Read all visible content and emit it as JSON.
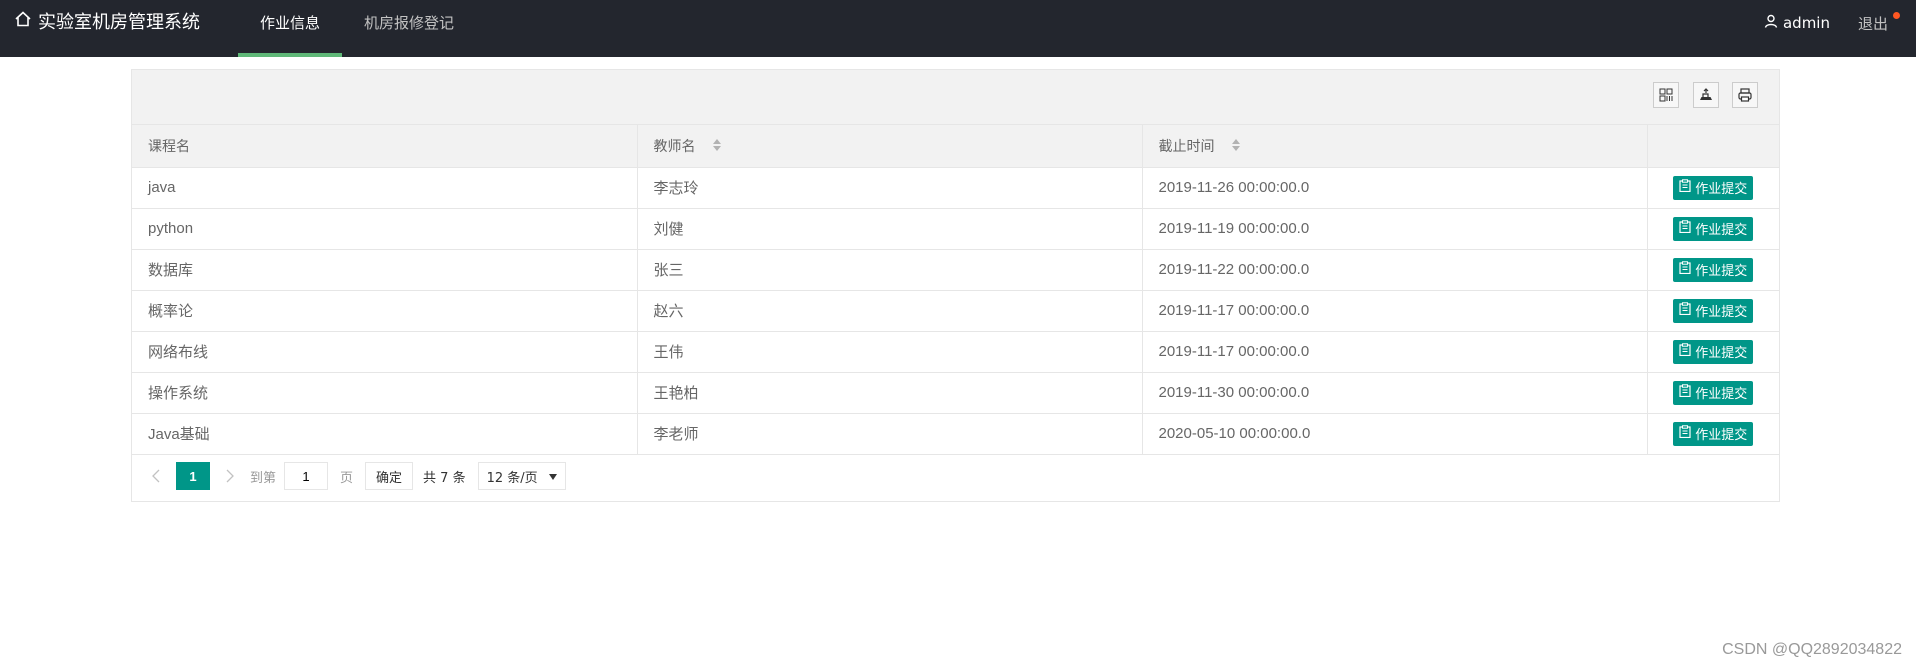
{
  "header": {
    "app_title": "实验室机房管理系统",
    "nav": [
      {
        "label": "作业信息",
        "active": true
      },
      {
        "label": "机房报修登记",
        "active": false
      }
    ],
    "user": "admin",
    "logout": "退出"
  },
  "toolbar": {
    "icons": [
      "columns-icon",
      "export-icon",
      "print-icon"
    ]
  },
  "table": {
    "columns": [
      "课程名",
      "教师名",
      "截止时间",
      ""
    ],
    "rows": [
      {
        "course": "java",
        "teacher": "李志玲",
        "deadline": "2019-11-26 00:00:00.0",
        "action": "作业提交"
      },
      {
        "course": "python",
        "teacher": "刘健",
        "deadline": "2019-11-19 00:00:00.0",
        "action": "作业提交"
      },
      {
        "course": "数据库",
        "teacher": "张三",
        "deadline": "2019-11-22 00:00:00.0",
        "action": "作业提交"
      },
      {
        "course": "概率论",
        "teacher": "赵六",
        "deadline": "2019-11-17 00:00:00.0",
        "action": "作业提交"
      },
      {
        "course": "网络布线",
        "teacher": "王伟",
        "deadline": "2019-11-17 00:00:00.0",
        "action": "作业提交"
      },
      {
        "course": "操作系统",
        "teacher": "王艳柏",
        "deadline": "2019-11-30 00:00:00.0",
        "action": "作业提交"
      },
      {
        "course": "Java基础",
        "teacher": "李老师",
        "deadline": "2020-05-10 00:00:00.0",
        "action": "作业提交"
      }
    ]
  },
  "pager": {
    "current": "1",
    "goto_label": "到第",
    "goto_value": "1",
    "page_unit": "页",
    "confirm": "确定",
    "total": "共 7 条",
    "page_size": "12 条/页"
  },
  "colors": {
    "topbar": "#23262e",
    "nav_active_bar": "#5fb878",
    "primary": "#009688",
    "badge": "#ff5722"
  },
  "watermark": "CSDN @QQ2892034822"
}
